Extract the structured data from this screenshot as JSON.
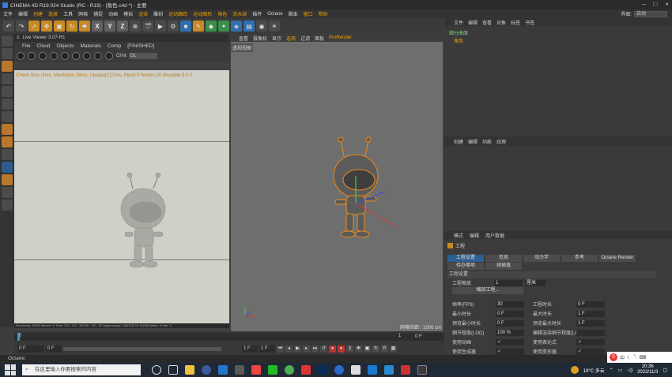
{
  "titlebar": {
    "title": "CINEMA 4D R19.024 Studio (RC - R19) - [角色.c4d *] - 主要"
  },
  "menu": [
    "文件",
    "编辑",
    "创建",
    "选择",
    "工具",
    "网格",
    "捕捉",
    "动画",
    "模拟",
    "渲染",
    "雕刻",
    "运动跟踪",
    "运动图形",
    "角色",
    "流水线",
    "插件",
    "Octane",
    "脚本",
    "窗口",
    "帮助"
  ],
  "menu_highlight": [
    "创建",
    "选择",
    "渲染",
    "运动跟踪",
    "运动图形",
    "角色",
    "流水线",
    "窗口",
    "帮助"
  ],
  "layout": {
    "label": "界面:",
    "value": "启动"
  },
  "live_viewer": {
    "title": "Live Viewer 3.07-R1",
    "menu": [
      "File",
      "Cloud",
      "Objects",
      "Materials",
      "Comp",
      "[FINISHED]"
    ],
    "channel_label": "Chnl:",
    "channel_value": "DL",
    "status_text": "Check:0ms./4ms. MeshGen:28ms. Update[C]:0ms. Mesh:9 Nodes:20 Movable:9  0 0",
    "footer": "Rendering: 100%    Ms/sec: 0   Time: 240 : 0/0 : 35/240 : 0/0 : 32   Spp/maxspp: 128/128   Tri: 0/195k   Mesh: 9   Hair: 0"
  },
  "viewport": {
    "tabs": [
      "查看",
      "摄像机",
      "显示",
      "选项",
      "过滤",
      "面板",
      "ProRender"
    ],
    "highlight": [
      "选项",
      "ProRender"
    ],
    "label": "透视视图",
    "scale": "网格间距 : 1000 cm"
  },
  "object_manager": {
    "tabs": [
      "文件",
      "编辑",
      "查看",
      "对象",
      "标签",
      "书签"
    ],
    "objects": [
      "细分曲面",
      "角色"
    ]
  },
  "panel2": {
    "tabs": [
      "创建",
      "编辑",
      "功能",
      "纹理"
    ]
  },
  "attributes": {
    "menu": [
      "模式",
      "编辑",
      "用户数据"
    ],
    "title": "工程",
    "buttons_row1": [
      "工程设置",
      "信息",
      "动力学",
      "参考",
      "Octane Render"
    ],
    "buttons_row2": [
      "待办事项",
      "帧插值"
    ],
    "section": "工程设置",
    "scale_label": "工程缩放",
    "scale_value": "1",
    "scale_unit": "厘米",
    "scale_button": "缩放工程...",
    "fields_left": [
      {
        "label": "帧率(FPS)",
        "value": "30"
      },
      {
        "label": "最小时长",
        "value": "0 F"
      },
      {
        "label": "预览最小时长",
        "value": "0 F"
      },
      {
        "label": "细节程度(LOD)",
        "value": "100 %"
      },
      {
        "label": "使用动画",
        "value": "✓"
      },
      {
        "label": "使用生成器",
        "value": "✓"
      }
    ],
    "fields_right": [
      {
        "label": "工程时长",
        "value": "0 F"
      },
      {
        "label": "最大时长",
        "value": "1 F"
      },
      {
        "label": "预览最大时长",
        "value": "1 F"
      },
      {
        "label": "编辑渲染细节程度(LOD)级别",
        "value": ""
      },
      {
        "label": "使用表达式",
        "value": "✓"
      },
      {
        "label": "使用变形器",
        "value": "✓"
      }
    ]
  },
  "timeline": {
    "start": "0 F",
    "field2": "0 F",
    "end": "1 F",
    "field4": "1 F",
    "current": "0 F",
    "ticks": [
      "0",
      "1"
    ]
  },
  "octane_bar": "Octane:",
  "taskbar": {
    "search_placeholder": "在这里输入你要搜索的内容",
    "weather": "19°C 多云",
    "time": "20:36",
    "date": "2022/11/3",
    "ime_label": "中"
  }
}
